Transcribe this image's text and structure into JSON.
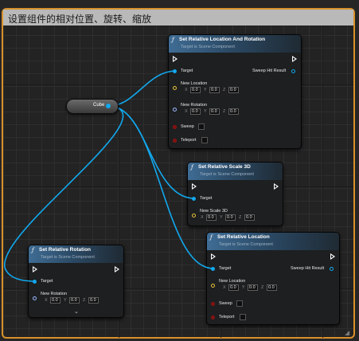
{
  "comment": {
    "title": "设置组件的相对位置、旋转、缩放",
    "color": "#d9912a"
  },
  "variable_node": {
    "label": "Cube",
    "pin_color": "#12a8ee"
  },
  "nodes": {
    "loc_rot": {
      "title": "Set Relative Location And Rotation",
      "subtitle": "Target is Scene Component",
      "target_label": "Target",
      "sweep_hit_label": "Sweep Hit Result",
      "new_location_label": "New Location",
      "new_location": {
        "x": "0.0",
        "y": "0.0",
        "z": "0.0"
      },
      "new_rotation_label": "New Rotation",
      "new_rotation": {
        "x": "0.0",
        "y": "0.0",
        "z": "0.0"
      },
      "sweep_label": "Sweep",
      "teleport_label": "Teleport"
    },
    "scale": {
      "title": "Set Relative Scale 3D",
      "subtitle": "Target is Scene Component",
      "target_label": "Target",
      "new_scale_label": "New Scale 3D",
      "new_scale": {
        "x": "0.0",
        "y": "0.0",
        "z": "0.0"
      }
    },
    "location": {
      "title": "Set Relative Location",
      "subtitle": "Target is Scene Component",
      "target_label": "Target",
      "sweep_hit_label": "Sweep Hit Result",
      "new_location_label": "New Location",
      "new_location": {
        "x": "0.0",
        "y": "0.0",
        "z": "0.0"
      },
      "sweep_label": "Sweep",
      "teleport_label": "Teleport"
    },
    "rotation": {
      "title": "Set Relative Rotation",
      "subtitle": "Target is Scene Component",
      "target_label": "Target",
      "new_rotation_label": "New Rotation",
      "new_rotation": {
        "x": "0.0",
        "y": "0.0",
        "z": "0.0"
      }
    }
  },
  "axes": {
    "x": "X",
    "y": "Y",
    "z": "Z"
  },
  "icons": {
    "function": "function-icon",
    "exec": "exec-pin-icon",
    "expand": "chevron-down-icon",
    "grip": "resize-grip-icon"
  },
  "colors": {
    "object_pin": "#12a8ee",
    "vector_pin": "#e9c23d",
    "rotator_pin": "#9db7ff",
    "bool_pin": "#951515",
    "header_blue": "#3f6c94"
  }
}
